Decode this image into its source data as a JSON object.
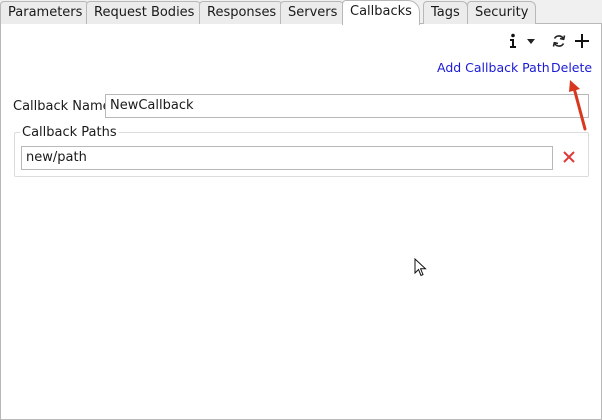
{
  "tabs": [
    {
      "label": "Parameters",
      "active": false
    },
    {
      "label": "Request Bodies",
      "active": false
    },
    {
      "label": "Responses",
      "active": false
    },
    {
      "label": "Servers",
      "active": false
    },
    {
      "label": "Callbacks",
      "active": true
    },
    {
      "label": "Tags",
      "active": false
    },
    {
      "label": "Security",
      "active": false
    }
  ],
  "toolbar": {
    "info_icon": "info-icon",
    "dropdown_icon": "chevron-down-icon",
    "refresh_icon": "refresh-icon",
    "add_icon": "plus-icon"
  },
  "links": {
    "add_callback_path": "Add Callback Path",
    "delete": "Delete"
  },
  "callback_name": {
    "label": "Callback Name",
    "value": "NewCallback"
  },
  "callback_paths": {
    "title": "Callback Paths",
    "items": [
      {
        "value": "new/path"
      }
    ]
  },
  "colors": {
    "link": "#1a1ad6",
    "delete_x": "#e03a3a",
    "annotation": "#d8381e"
  }
}
